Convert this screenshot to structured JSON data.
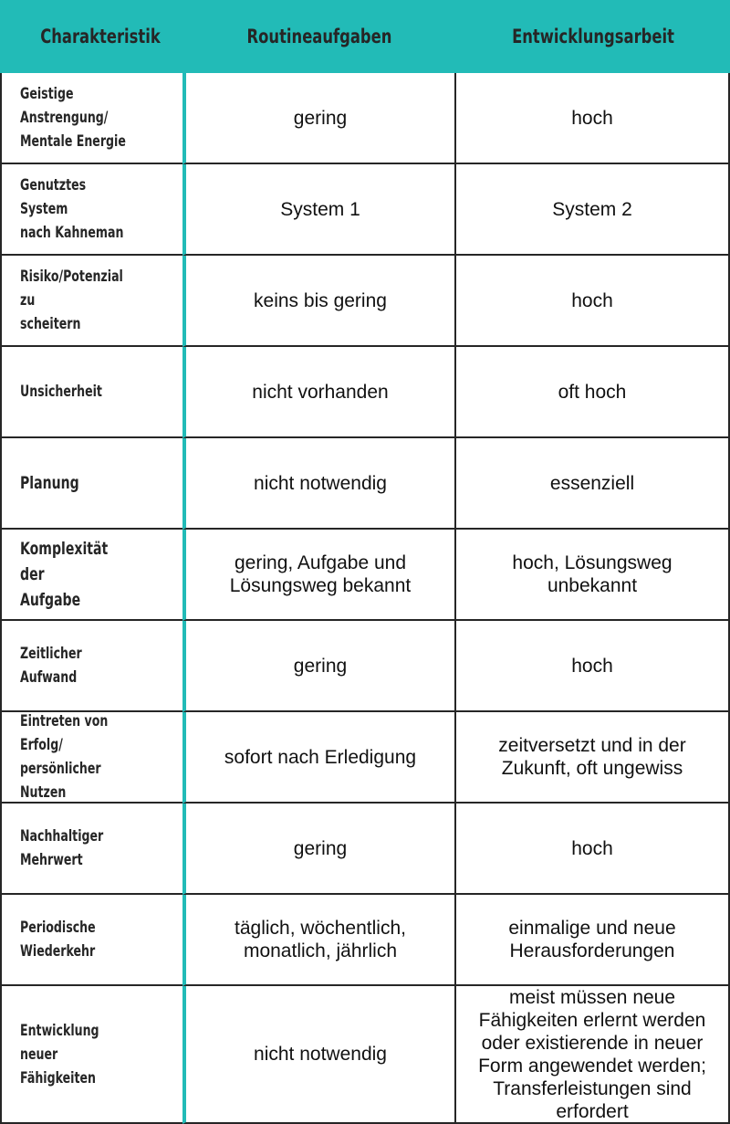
{
  "header": {
    "columns": [
      "Charakteristik",
      "Routineaufgaben",
      "Entwicklungsarbeit"
    ]
  },
  "colors": {
    "accent": "#22bbb7",
    "border": "#262626",
    "text": "#111111"
  },
  "rows": [
    {
      "label": "Geistige\nAnstrengung/\nMentale Energie",
      "routine": "gering",
      "entwicklung": "hoch"
    },
    {
      "label": "Genutztes System\nnach Kahneman",
      "routine": "System 1",
      "entwicklung": "System 2"
    },
    {
      "label": "Risiko/Potenzial zu\nscheitern",
      "routine": "keins bis gering",
      "entwicklung": "hoch"
    },
    {
      "label": "Unsicherheit",
      "routine": "nicht vorhanden",
      "entwicklung": "oft hoch"
    },
    {
      "label": "Planung",
      "routine": "nicht notwendig",
      "entwicklung": "essenziell"
    },
    {
      "label": "Komplexität der\nAufgabe",
      "routine": "gering, Aufgabe und\nLösungsweg bekannt",
      "entwicklung": "hoch, Lösungsweg\nunbekannt"
    },
    {
      "label": "Zeitlicher Aufwand",
      "routine": "gering",
      "entwicklung": "hoch"
    },
    {
      "label": "Eintreten von Erfolg/\npersönlicher Nutzen",
      "routine": "sofort nach Erledigung",
      "entwicklung": "zeitversetzt und in der\nZukunft, oft ungewiss"
    },
    {
      "label": "Nachhaltiger\nMehrwert",
      "routine": "gering",
      "entwicklung": "hoch"
    },
    {
      "label": "Periodische\nWiederkehr",
      "routine": "täglich, wöchentlich,\nmonatlich, jährlich",
      "entwicklung": "einmalige und neue\nHerausforderungen"
    },
    {
      "label": "Entwicklung neuer\nFähigkeiten",
      "routine": "nicht notwendig",
      "entwicklung": "meist müssen neue\nFähigkeiten erlernt werden\noder existierende in neuer\nForm angewendet werden;\nTransferleistungen sind\nerfordert"
    }
  ]
}
